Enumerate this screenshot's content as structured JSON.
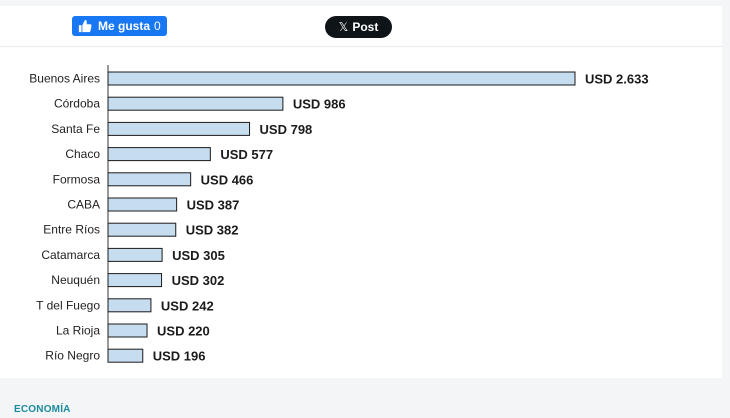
{
  "share": {
    "like_label": "Me gusta",
    "like_count": "0",
    "post_label": "Post",
    "post_logo": "𝕏"
  },
  "section": "ECONOMÍA",
  "colors": {
    "bar_fill": "#c6dcef",
    "bar_stroke": "#1b1b1b",
    "accent": "#1a8b9d",
    "fb": "#1877f2"
  },
  "chart_data": {
    "type": "bar",
    "orientation": "horizontal",
    "categories": [
      "Buenos Aires",
      "Córdoba",
      "Santa Fe",
      "Chaco",
      "Formosa",
      "CABA",
      "Entre Ríos",
      "Catamarca",
      "Neuquén",
      "T del Fuego",
      "La Rioja",
      "Río Negro"
    ],
    "values": [
      2633,
      986,
      798,
      577,
      466,
      387,
      382,
      305,
      302,
      242,
      220,
      196
    ],
    "value_labels": [
      "USD 2.633",
      "USD 986",
      "USD 798",
      "USD 577",
      "USD 466",
      "USD 387",
      "USD 382",
      "USD 305",
      "USD 302",
      "USD 242",
      "USD 220",
      "USD 196"
    ],
    "title": "",
    "xlabel": "",
    "ylabel": "",
    "grid": false,
    "legend": "none"
  }
}
